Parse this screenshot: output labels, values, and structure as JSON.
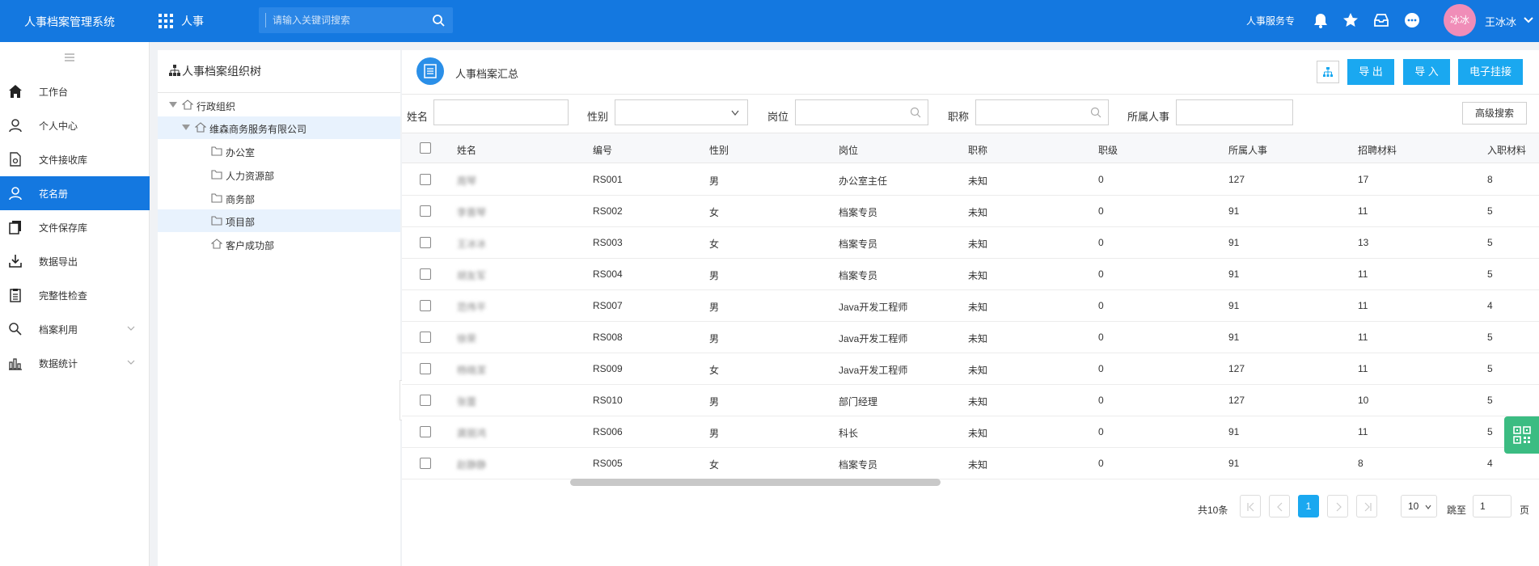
{
  "topbar": {
    "system_name": "人事档案管理系统",
    "module": "人事",
    "search_placeholder": "请输入关键词搜索",
    "hr_service": "人事服务专",
    "avatar_text": "冰冰",
    "username": "王冰冰"
  },
  "sidebar": {
    "items": [
      {
        "label": "工作台",
        "icon": "home-icon"
      },
      {
        "label": "个人中心",
        "icon": "user-icon"
      },
      {
        "label": "文件接收库",
        "icon": "file-receive-icon"
      },
      {
        "label": "花名册",
        "icon": "person-icon",
        "active": true
      },
      {
        "label": "文件保存库",
        "icon": "file-store-icon"
      },
      {
        "label": "数据导出",
        "icon": "download-icon"
      },
      {
        "label": "完整性检查",
        "icon": "checklist-icon"
      },
      {
        "label": "档案利用",
        "icon": "search-icon",
        "expandable": true
      },
      {
        "label": "数据统计",
        "icon": "bar-chart-icon",
        "expandable": true
      }
    ]
  },
  "tree": {
    "title": "人事档案组织树",
    "nodes": [
      {
        "label": "行政组织"
      },
      {
        "label": "维森商务服务有限公司"
      },
      {
        "label": "办公室"
      },
      {
        "label": "人力资源部"
      },
      {
        "label": "商务部"
      },
      {
        "label": "项目部"
      },
      {
        "label": "客户成功部"
      }
    ]
  },
  "main": {
    "title": "人事档案汇总",
    "buttons": {
      "export": "导 出",
      "import": "导 入",
      "e_attach": "电子挂接"
    },
    "filters": {
      "name_label": "姓名",
      "gender_label": "性别",
      "post_label": "岗位",
      "title_label": "职称",
      "hr_label": "所属人事",
      "advanced": "高级搜索"
    },
    "columns": [
      "姓名",
      "编号",
      "性别",
      "岗位",
      "职称",
      "职级",
      "所属人事",
      "招聘材料",
      "入职材料"
    ],
    "rows": [
      [
        "周琴",
        "RS001",
        "男",
        "办公室主任",
        "未知",
        "0",
        "127",
        "17",
        "8"
      ],
      [
        "李晋琴",
        "RS002",
        "女",
        "档案专员",
        "未知",
        "0",
        "91",
        "11",
        "5"
      ],
      [
        "王冰冰",
        "RS003",
        "女",
        "档案专员",
        "未知",
        "0",
        "91",
        "13",
        "5"
      ],
      [
        "胡友军",
        "RS004",
        "男",
        "档案专员",
        "未知",
        "0",
        "91",
        "11",
        "5"
      ],
      [
        "范伟平",
        "RS007",
        "男",
        "Java开发工程师",
        "未知",
        "0",
        "91",
        "11",
        "4"
      ],
      [
        "徐荣",
        "RS008",
        "男",
        "Java开发工程师",
        "未知",
        "0",
        "91",
        "11",
        "5"
      ],
      [
        "杨晓潔",
        "RS009",
        "女",
        "Java开发工程师",
        "未知",
        "0",
        "127",
        "11",
        "5"
      ],
      [
        "张蕾",
        "RS010",
        "男",
        "部门经理",
        "未知",
        "0",
        "127",
        "10",
        "5"
      ],
      [
        "龚丽鸿",
        "RS006",
        "男",
        "科长",
        "未知",
        "0",
        "91",
        "11",
        "5"
      ],
      [
        "赵静静",
        "RS005",
        "女",
        "档案专员",
        "未知",
        "0",
        "91",
        "8",
        "4"
      ]
    ],
    "pagination": {
      "total": "共10条",
      "current_page": "1",
      "page_size": "10",
      "goto_label": "跳至",
      "goto_value": "1",
      "page_suffix": "页"
    }
  },
  "colors": {
    "primary": "#1478e0",
    "button": "#1aa8f0",
    "avatar": "#f08db8",
    "float": "#3bbc82"
  }
}
